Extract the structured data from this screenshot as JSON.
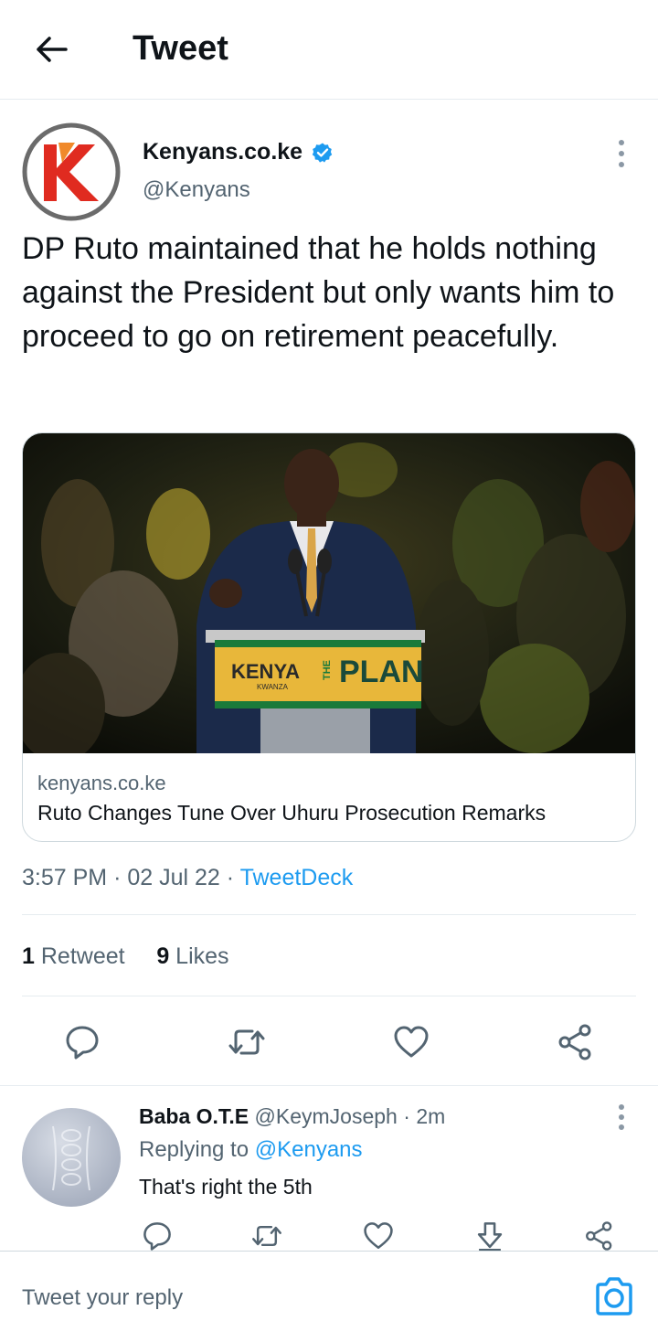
{
  "header": {
    "title": "Tweet"
  },
  "tweet": {
    "author_name": "Kenyans.co.ke",
    "author_handle": "@Kenyans",
    "text": "DP Ruto maintained that he holds nothing against the President but only wants him to proceed to go on retirement peacefully.",
    "card": {
      "domain": "kenyans.co.ke",
      "title": "Ruto Changes Tune Over Uhuru Prosecution Remarks",
      "image_sign": {
        "left": "KENYA",
        "left_sub": "KWANZA",
        "right_vertical": "THE",
        "right": "PLAN"
      }
    },
    "time": "3:57 PM",
    "date": "02 Jul 22",
    "source": "TweetDeck",
    "stats": {
      "retweets_count": "1",
      "retweets_label": "Retweet",
      "likes_count": "9",
      "likes_label": "Likes"
    }
  },
  "reply": {
    "author_name": "Baba O.T.E",
    "author_handle": "@KeymJoseph",
    "age": "2m",
    "replying_prefix": "Replying to",
    "replying_to": "@Kenyans",
    "text": "That's right the 5th"
  },
  "composer": {
    "placeholder": "Tweet your reply"
  },
  "colors": {
    "accent": "#1d9bf0",
    "verified": "#1d9bf0",
    "logo_red": "#e02b20",
    "logo_orange": "#f0892a",
    "text": "#0f1419",
    "muted": "#536471"
  },
  "icons": [
    "back-arrow-icon",
    "verified-icon",
    "more-icon",
    "reply-icon",
    "retweet-icon",
    "like-icon",
    "share-icon",
    "download-icon",
    "camera-icon"
  ]
}
